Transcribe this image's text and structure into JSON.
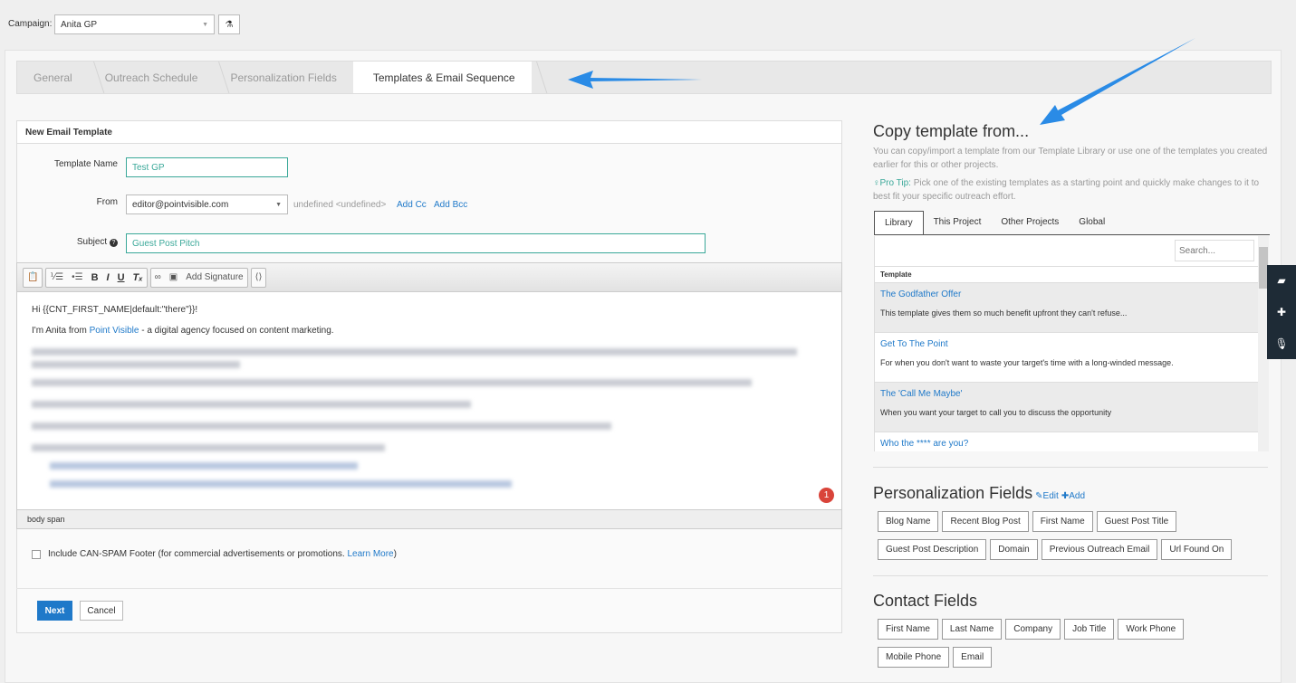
{
  "campaign": {
    "label": "Campaign:",
    "value": "Anita GP"
  },
  "breadcrumb": [
    "General",
    "Outreach Schedule",
    "Personalization Fields",
    "Templates & Email Sequence"
  ],
  "form": {
    "title": "New Email Template",
    "template_name_label": "Template Name",
    "template_name": "Test GP",
    "from_label": "From",
    "from_value": "editor@pointvisible.com",
    "from_extra": "undefined <undefined>",
    "add_cc": "Add Cc",
    "add_bcc": "Add Bcc",
    "subject_label": "Subject",
    "subject": "Guest Post Pitch",
    "add_signature": "Add Signature",
    "body_line1": "Hi {{CNT_FIRST_NAME|default:\"there\"}}!",
    "body_line2_pre": "I'm Anita from ",
    "body_link": "Point Visible",
    "body_line2_post": " - a digital agency focused on content marketing.",
    "status_path": "body  span",
    "badge": "1",
    "canspam": "Include CAN-SPAM Footer (for commercial advertisements or promotions.",
    "learn_more": "Learn More",
    "next": "Next",
    "cancel": "Cancel"
  },
  "copy": {
    "title": "Copy template from...",
    "desc": "You can copy/import a template from our Template Library or use one of the templates you created earlier for this or other projects.",
    "tip_label": "Pro Tip:",
    "tip": " Pick one of the existing templates as a starting point and quickly make changes to it to best fit your specific outreach effort.",
    "tabs": [
      "Library",
      "This Project",
      "Other Projects",
      "Global"
    ],
    "search_placeholder": "Search...",
    "column": "Template",
    "templates": [
      {
        "name": "The Godfather Offer",
        "desc": "This template gives them so much benefit upfront they can't refuse..."
      },
      {
        "name": "Get To The Point",
        "desc": "For when you don't want to waste your target's time with a long-winded message."
      },
      {
        "name": "The 'Call Me Maybe'",
        "desc": "When you want your target to call you to discuss the opportunity"
      },
      {
        "name": "Who the **** are you?",
        "desc": ""
      }
    ]
  },
  "personalization": {
    "title": "Personalization Fields",
    "edit": "Edit",
    "add": "Add",
    "fields": [
      "Blog Name",
      "Recent Blog Post",
      "First Name",
      "Guest Post Title",
      "Guest Post Description",
      "Domain",
      "Previous Outreach Email",
      "Url Found On"
    ]
  },
  "contact": {
    "title": "Contact Fields",
    "fields": [
      "First Name",
      "Last Name",
      "Company",
      "Job Title",
      "Work Phone",
      "Mobile Phone",
      "Email"
    ]
  },
  "colors": {
    "accent": "#1f79c9",
    "teal": "#3aa899",
    "arrow": "#2a8be6"
  }
}
